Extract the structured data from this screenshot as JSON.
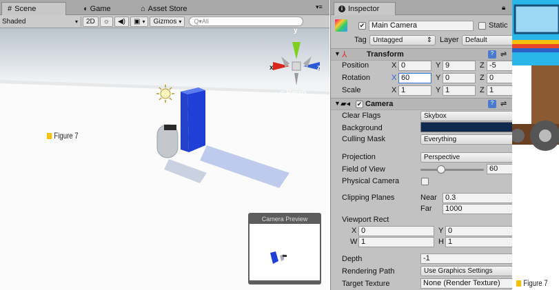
{
  "scene_panel": {
    "tabs": [
      {
        "icon": "hash-icon",
        "label": "Scene"
      },
      {
        "icon": "pacman-icon",
        "label": "Game"
      },
      {
        "icon": "store-icon",
        "label": "Asset Store"
      }
    ],
    "toolbar": {
      "shading": "Shaded",
      "mode_2d": "2D",
      "gizmos": "Gizmos",
      "search_placeholder": "Q▾All"
    },
    "persp_label": "< Persp",
    "gizmo_axes": {
      "y": "y",
      "x": "x",
      "z": "z"
    },
    "camera_preview_title": "Camera Preview"
  },
  "figure_labels": {
    "left": "Figure 7",
    "right": "Figure 7"
  },
  "inspector": {
    "tab": "Inspector",
    "object_name": "Main Camera",
    "static_label": "Static",
    "tag_label": "Tag",
    "tag_value": "Untagged",
    "layer_label": "Layer",
    "layer_value": "Default",
    "transform": {
      "title": "Transform",
      "position": {
        "label": "Position",
        "x": "0",
        "y": "9",
        "z": "-5"
      },
      "rotation": {
        "label": "Rotation",
        "x": "60",
        "y": "0",
        "z": "0"
      },
      "scale": {
        "label": "Scale",
        "x": "1",
        "y": "1",
        "z": "1"
      }
    },
    "camera": {
      "title": "Camera",
      "clear_flags": {
        "label": "Clear Flags",
        "value": "Skybox"
      },
      "background": {
        "label": "Background",
        "color": "#0f2a4e"
      },
      "culling_mask": {
        "label": "Culling Mask",
        "value": "Everything"
      },
      "projection": {
        "label": "Projection",
        "value": "Perspective"
      },
      "field_of_view": {
        "label": "Field of View",
        "value": "60",
        "slider_fraction": 0.33
      },
      "physical_camera": {
        "label": "Physical Camera"
      },
      "clipping_planes": {
        "label": "Clipping Planes",
        "near_label": "Near",
        "near": "0.3",
        "far_label": "Far",
        "far": "1000"
      },
      "viewport_rect": {
        "label": "Viewport Rect",
        "x": "0",
        "y": "0",
        "w": "1",
        "h": "1"
      },
      "depth": {
        "label": "Depth",
        "value": "-1"
      },
      "rendering_path": {
        "label": "Rendering Path",
        "value": "Use Graphics Settings"
      },
      "target_texture": {
        "label": "Target Texture",
        "value": "None (Render Texture)"
      }
    }
  },
  "colors": {
    "blue_box": "#1f3fd6",
    "gizmo_y": "#7fcf1f",
    "gizmo_x": "#d9261c",
    "gizmo_z": "#2a5ad6",
    "figure_square": "#f4c20d"
  }
}
